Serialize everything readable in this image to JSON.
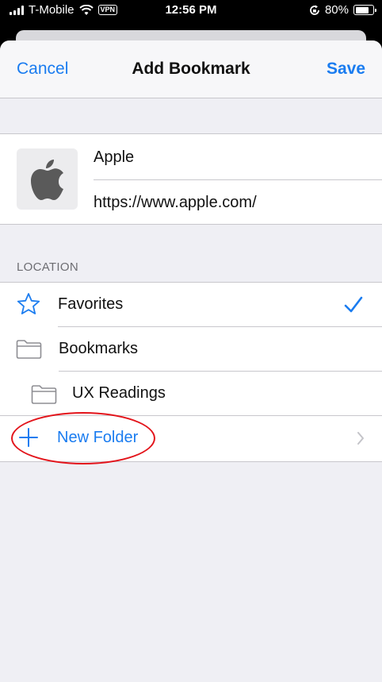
{
  "status_bar": {
    "carrier": "T-Mobile",
    "vpn_label": "VPN",
    "time": "12:56 PM",
    "battery_percent": "80%",
    "battery_level": 0.8
  },
  "nav": {
    "cancel_label": "Cancel",
    "title": "Add Bookmark",
    "save_label": "Save"
  },
  "bookmark": {
    "title_value": "Apple",
    "url_value": "https://www.apple.com/",
    "thumbnail_icon": "apple-logo-icon"
  },
  "location": {
    "header": "LOCATION",
    "items": [
      {
        "label": "Favorites",
        "icon": "star-icon",
        "selected": true
      },
      {
        "label": "Bookmarks",
        "icon": "folder-icon",
        "selected": false
      },
      {
        "label": "UX Readings",
        "icon": "folder-icon",
        "selected": false
      }
    ],
    "new_folder_label": "New Folder"
  },
  "colors": {
    "accent": "#1a7cf0",
    "annotation": "#e3141b",
    "background": "#efeff4"
  }
}
